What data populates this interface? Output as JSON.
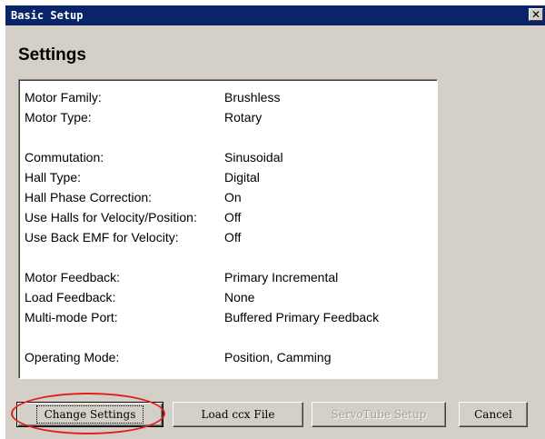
{
  "window": {
    "title": "Basic Setup",
    "close_glyph": "✕"
  },
  "heading": "Settings",
  "settings": [
    {
      "label": "Motor Family:",
      "value": "Brushless"
    },
    {
      "label": "Motor Type:",
      "value": "Rotary"
    },
    {
      "label": "Commutation:",
      "value": "Sinusoidal"
    },
    {
      "label": "Hall Type:",
      "value": "Digital"
    },
    {
      "label": "Hall Phase Correction:",
      "value": "On"
    },
    {
      "label": "Use Halls for Velocity/Position:",
      "value": "Off"
    },
    {
      "label": "Use Back EMF for Velocity:",
      "value": "Off"
    },
    {
      "label": "Motor Feedback:",
      "value": "Primary Incremental"
    },
    {
      "label": "Load Feedback:",
      "value": "None"
    },
    {
      "label": "Multi-mode Port:",
      "value": "Buffered Primary Feedback"
    },
    {
      "label": "Operating Mode:",
      "value": "Position, Camming"
    }
  ],
  "buttons": {
    "change_settings": "Change Settings",
    "load_ccx": "Load ccx File",
    "servotube": "ServoTube Setup",
    "cancel": "Cancel"
  },
  "colors": {
    "title_bar": "#0a246a",
    "highlight": "#e0201a",
    "dialog_bg": "#d4d0c8"
  }
}
